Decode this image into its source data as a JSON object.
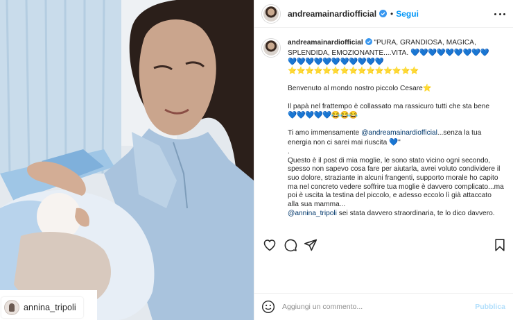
{
  "photo": {
    "tag_username": "annina_tripoli"
  },
  "header": {
    "username": "andreamainardiofficial",
    "verified_icon": "verified-badge-icon",
    "separator": "•",
    "follow_label": "Segui",
    "more_icon": "more-options-icon"
  },
  "caption": {
    "username": "andreamainardiofficial",
    "line1": "\"PURA, GRANDIOSA, MAGICA, SPLENDIDA, EMOZIONANTE....VITA.",
    "hearts_row1": "💙💙💙💙💙💙💙💙💙",
    "hearts_row2": "💙💙💙💙💙💙💙💙💙💙💙",
    "stars_row": "⭐⭐⭐⭐⭐⭐⭐⭐⭐⭐⭐⭐⭐⭐⭐",
    "welcome": "Benvenuto al mondo nostro piccolo Cesare",
    "welcome_emoji": "⭐",
    "papa": "Il papà nel frattempo è collassato ma rassicuro tutti che sta bene",
    "papa_hearts": "💙💙💙💙💙",
    "papa_smiles": "😂😂😂",
    "love_prefix": "Ti amo immensamente ",
    "love_mention": "@andreamainardiofficial",
    "love_suffix": "...senza la tua energia non ci sarei mai riuscita ",
    "love_heart": "💙",
    "love_close": "\"",
    "dot": ".",
    "story": "Questo è il post di mia moglie, le sono stato vicino ogni secondo, spesso non sapevo cosa fare per aiutarla, avrei voluto condividere il suo dolore, straziante in alcuni frangenti, supporto morale ho capito ma nel concreto vedere soffrire tua moglie è davvero complicato...ma poi è uscita la testina del piccolo, e adesso eccolo lì già attaccato alla sua mamma...",
    "final_mention": "@annina_tripoli",
    "final_text": " sei stata davvero straordinaria, te lo dico davvero."
  },
  "actions": {
    "like_icon": "heart-outline-icon",
    "comment_icon": "comment-bubble-icon",
    "share_icon": "paper-plane-icon",
    "save_icon": "bookmark-icon"
  },
  "comment_bar": {
    "emoji_icon": "smiley-icon",
    "placeholder": "Aggiungi un commento...",
    "value": "",
    "publish_label": "Pubblica"
  },
  "colors": {
    "accent_blue": "#0095f6",
    "publish_disabled": "#b2dffc",
    "mention": "#00376b",
    "text": "#262626",
    "muted": "#8e8e8e",
    "border": "#efefef"
  }
}
